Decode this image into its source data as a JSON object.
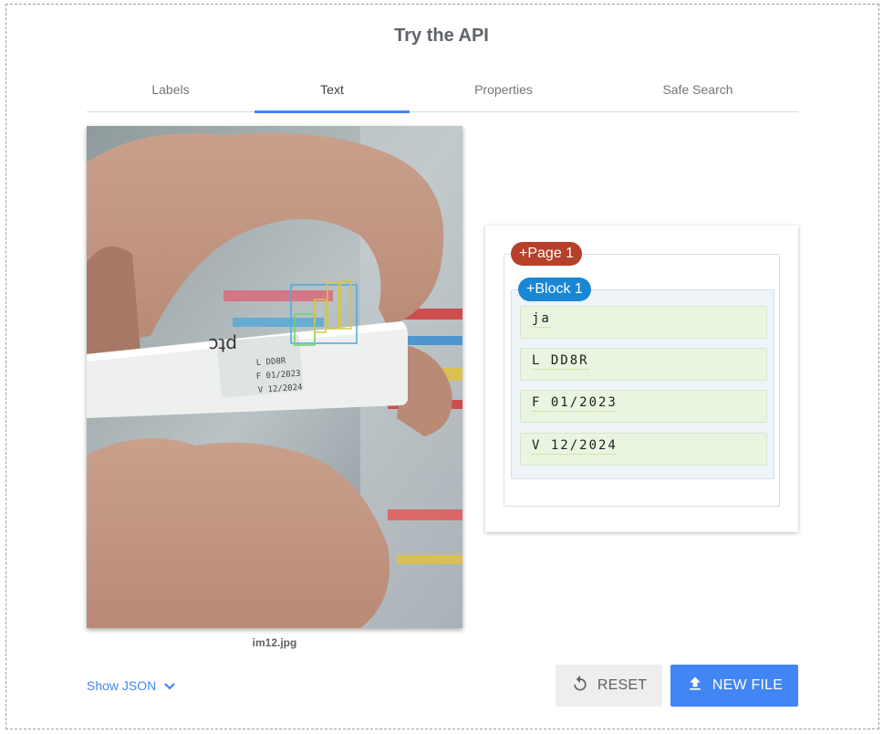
{
  "title": "Try the API",
  "tabs": [
    {
      "label": "Labels",
      "active": false
    },
    {
      "label": "Text",
      "active": true
    },
    {
      "label": "Properties",
      "active": false
    },
    {
      "label": "Safe Search",
      "active": false
    }
  ],
  "image": {
    "filename": "im12.jpg",
    "package_text": [
      "ptc",
      "L DD8R",
      "F 01/2023",
      "V 12/2024"
    ]
  },
  "results": {
    "page_label": "+Page 1",
    "block_label": "+Block 1",
    "paragraphs": [
      "ja",
      "L DD8R",
      "F 01/2023",
      "V 12/2024"
    ]
  },
  "footer": {
    "show_json_label": "Show JSON",
    "reset_label": "RESET",
    "new_file_label": "NEW FILE"
  },
  "colors": {
    "accent": "#4285f4",
    "page_pill": "#b7402a",
    "block_pill": "#1a86d6",
    "paragraph_bg": "#e8f5e1",
    "block_bg": "#eef4f8"
  },
  "icons": {
    "show_json": "chevron-down-icon",
    "reset": "refresh-icon",
    "new_file": "upload-icon"
  }
}
